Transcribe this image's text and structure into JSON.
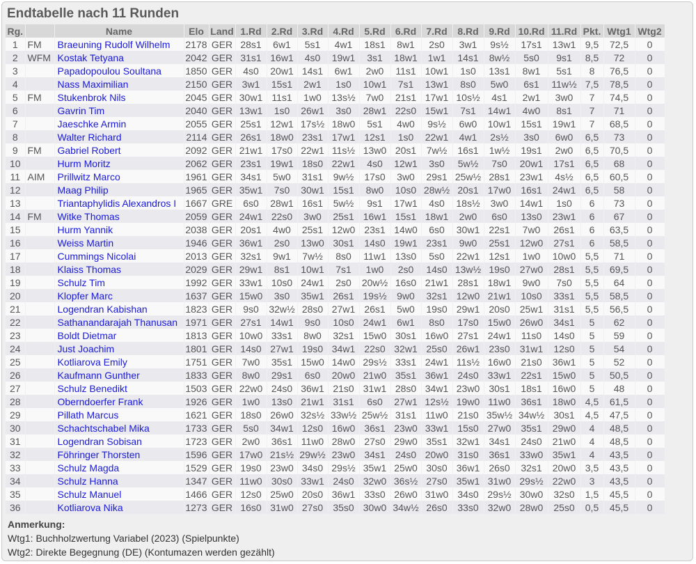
{
  "title": "Endtabelle nach 11 Runden",
  "headers": [
    "Rg.",
    "",
    "Name",
    "Elo",
    "Land",
    "1.Rd",
    "2.Rd",
    "3.Rd",
    "4.Rd",
    "5.Rd",
    "6.Rd",
    "7.Rd",
    "8.Rd",
    "9.Rd",
    "10.Rd",
    "11.Rd",
    "Pkt.",
    "Wtg1",
    "Wtg2"
  ],
  "rows": [
    [
      "1",
      "FM",
      "Braeuning Rudolf Wilhelm",
      "2178",
      "GER",
      "28s1",
      "6w1",
      "5s1",
      "4w1",
      "18s1",
      "8w1",
      "2s0",
      "3w1",
      "9s½",
      "17s1",
      "13w1",
      "9,5",
      "72,5",
      "0"
    ],
    [
      "2",
      "WFM",
      "Kostak Tetyana",
      "2042",
      "GER",
      "31s1",
      "16w1",
      "4s0",
      "19w1",
      "3s1",
      "18w1",
      "1w1",
      "14s1",
      "8w½",
      "5s0",
      "9s1",
      "8,5",
      "72",
      "0"
    ],
    [
      "3",
      "",
      "Papadopoulou Soultana",
      "1850",
      "GER",
      "4s0",
      "20w1",
      "14s1",
      "6w1",
      "2w0",
      "11s1",
      "10w1",
      "1s0",
      "13s1",
      "8w1",
      "5s1",
      "8",
      "76,5",
      "0"
    ],
    [
      "4",
      "",
      "Nass Maximilian",
      "2150",
      "GER",
      "3w1",
      "15s1",
      "2w1",
      "1s0",
      "10w1",
      "7s1",
      "13w1",
      "8s0",
      "5w0",
      "6s1",
      "11w½",
      "7,5",
      "78,5",
      "0"
    ],
    [
      "5",
      "FM",
      "Stukenbrok Nils",
      "2045",
      "GER",
      "30w1",
      "11s1",
      "1w0",
      "13s½",
      "7w0",
      "21s1",
      "17w1",
      "10s½",
      "4s1",
      "2w1",
      "3w0",
      "7",
      "74,5",
      "0"
    ],
    [
      "6",
      "",
      "Gavrin Tim",
      "2040",
      "GER",
      "13w1",
      "1s0",
      "26w1",
      "3s0",
      "28w1",
      "22s0",
      "15w1",
      "7s1",
      "14w1",
      "4w0",
      "8s1",
      "7",
      "71",
      "0"
    ],
    [
      "7",
      "",
      "Jaeschke Armin",
      "2055",
      "GER",
      "25s1",
      "12w1",
      "17s½",
      "18w0",
      "5s1",
      "4w0",
      "9s½",
      "6w0",
      "10w1",
      "15s1",
      "19w1",
      "7",
      "68,5",
      "0"
    ],
    [
      "8",
      "",
      "Walter Richard",
      "2114",
      "GER",
      "26s1",
      "18w0",
      "23s1",
      "17w1",
      "12s1",
      "1s0",
      "22w1",
      "4w1",
      "2s½",
      "3s0",
      "6w0",
      "6,5",
      "73",
      "0"
    ],
    [
      "9",
      "FM",
      "Gabriel Robert",
      "2092",
      "GER",
      "21w1",
      "17s0",
      "22w1",
      "11s½",
      "13w0",
      "20s1",
      "7w½",
      "16s1",
      "1w½",
      "19s1",
      "2w0",
      "6,5",
      "70,5",
      "0"
    ],
    [
      "10",
      "",
      "Hurm Moritz",
      "2062",
      "GER",
      "23s1",
      "19w1",
      "18s0",
      "22w1",
      "4s0",
      "12w1",
      "3s0",
      "5w½",
      "7s0",
      "20w1",
      "17s1",
      "6,5",
      "68",
      "0"
    ],
    [
      "11",
      "AIM",
      "Prillwitz Marco",
      "1961",
      "GER",
      "34s1",
      "5w0",
      "31s1",
      "9w½",
      "17s0",
      "3w0",
      "29s1",
      "25w½",
      "28s1",
      "23w1",
      "4s½",
      "6,5",
      "60,5",
      "0"
    ],
    [
      "12",
      "",
      "Maag Philip",
      "1965",
      "GER",
      "35w1",
      "7s0",
      "30w1",
      "15s1",
      "8w0",
      "10s0",
      "28w½",
      "20s1",
      "17w0",
      "16s1",
      "24w1",
      "6,5",
      "58",
      "0"
    ],
    [
      "13",
      "",
      "Triantaphylidis Alexandros I",
      "1667",
      "GRE",
      "6s0",
      "28w1",
      "16s1",
      "5w½",
      "9s1",
      "17w1",
      "4s0",
      "18s½",
      "3w0",
      "14w1",
      "1s0",
      "6",
      "73",
      "0"
    ],
    [
      "14",
      "FM",
      "Witke Thomas",
      "2059",
      "GER",
      "24w1",
      "22s0",
      "3w0",
      "25s1",
      "16w1",
      "15s1",
      "18w1",
      "2w0",
      "6s0",
      "13s0",
      "23w1",
      "6",
      "67",
      "0"
    ],
    [
      "15",
      "",
      "Hurm Yannik",
      "2038",
      "GER",
      "20s1",
      "4w0",
      "25s1",
      "12w0",
      "23s1",
      "14w0",
      "6s0",
      "30w1",
      "22s1",
      "7w0",
      "26s1",
      "6",
      "63,5",
      "0"
    ],
    [
      "16",
      "",
      "Weiss Martin",
      "1946",
      "GER",
      "36w1",
      "2s0",
      "13w0",
      "30s1",
      "14s0",
      "19w1",
      "23s1",
      "9w0",
      "25s1",
      "12w0",
      "27s1",
      "6",
      "58,5",
      "0"
    ],
    [
      "17",
      "",
      "Cummings Nicolai",
      "2013",
      "GER",
      "32s1",
      "9w1",
      "7w½",
      "8s0",
      "11w1",
      "13s0",
      "5s0",
      "22w1",
      "12s1",
      "1w0",
      "10w0",
      "5,5",
      "71",
      "0"
    ],
    [
      "18",
      "",
      "Klaiss Thomas",
      "2029",
      "GER",
      "29w1",
      "8s1",
      "10w1",
      "7s1",
      "1w0",
      "2s0",
      "14s0",
      "13w½",
      "19s0",
      "27w0",
      "28s1",
      "5,5",
      "69,5",
      "0"
    ],
    [
      "19",
      "",
      "Schulz Tim",
      "1992",
      "GER",
      "33w1",
      "10s0",
      "24w1",
      "2s0",
      "20w½",
      "16s0",
      "21w1",
      "28s1",
      "18w1",
      "9w0",
      "7s0",
      "5,5",
      "64",
      "0"
    ],
    [
      "20",
      "",
      "Klopfer Marc",
      "1637",
      "GER",
      "15w0",
      "3s0",
      "35w1",
      "26s1",
      "19s½",
      "9w0",
      "32s1",
      "12w0",
      "21w1",
      "10s0",
      "33s1",
      "5,5",
      "58,5",
      "0"
    ],
    [
      "21",
      "",
      "Logendran Kabishan",
      "1823",
      "GER",
      "9s0",
      "32w½",
      "28s0",
      "27w1",
      "26s1",
      "5w0",
      "19s0",
      "29w1",
      "20s0",
      "25w1",
      "31s1",
      "5,5",
      "56,5",
      "0"
    ],
    [
      "22",
      "",
      "Sathanandarajah Thanusan",
      "1971",
      "GER",
      "27s1",
      "14w1",
      "9s0",
      "10s0",
      "24w1",
      "6w1",
      "8s0",
      "17s0",
      "15w0",
      "26w0",
      "34s1",
      "5",
      "62",
      "0"
    ],
    [
      "23",
      "",
      "Boldt Dietmar",
      "1813",
      "GER",
      "10w0",
      "33s1",
      "8w0",
      "32s1",
      "15w0",
      "30s1",
      "16w0",
      "27s1",
      "24w1",
      "11s0",
      "14s0",
      "5",
      "59",
      "0"
    ],
    [
      "24",
      "",
      "Just Joachim",
      "1801",
      "GER",
      "14s0",
      "27w1",
      "19s0",
      "34w1",
      "22s0",
      "32w1",
      "25s0",
      "26w1",
      "23s0",
      "31w1",
      "12s0",
      "5",
      "54",
      "0"
    ],
    [
      "25",
      "",
      "Kotliarova Emily",
      "1751",
      "GER",
      "7w0",
      "35s1",
      "15w0",
      "14w0",
      "29s½",
      "33s1",
      "24w1",
      "11s½",
      "16w0",
      "21s0",
      "36w1",
      "5",
      "52",
      "0"
    ],
    [
      "26",
      "",
      "Kaufmann Gunther",
      "1833",
      "GER",
      "8w0",
      "29s1",
      "6s0",
      "20w0",
      "21w0",
      "35s1",
      "36w1",
      "24s0",
      "33w1",
      "22s1",
      "15w0",
      "5",
      "50,5",
      "0"
    ],
    [
      "27",
      "",
      "Schulz Benedikt",
      "1503",
      "GER",
      "22w0",
      "24s0",
      "36w1",
      "21s0",
      "31w1",
      "28s0",
      "34w1",
      "23w0",
      "30s1",
      "18s1",
      "16w0",
      "5",
      "48",
      "0"
    ],
    [
      "28",
      "",
      "Oberndoerfer Frank",
      "1926",
      "GER",
      "1w0",
      "13s0",
      "21w1",
      "31s1",
      "6s0",
      "27w1",
      "12s½",
      "19w0",
      "11w0",
      "36s1",
      "18w0",
      "4,5",
      "61,5",
      "0"
    ],
    [
      "29",
      "",
      "Pillath Marcus",
      "1621",
      "GER",
      "18s0",
      "26w0",
      "32s½",
      "33w½",
      "25w½",
      "31s1",
      "11w0",
      "21s0",
      "35w½",
      "34w½",
      "30s1",
      "4,5",
      "47,5",
      "0"
    ],
    [
      "30",
      "",
      "Schachtschabel Mika",
      "1733",
      "GER",
      "5s0",
      "34w1",
      "12s0",
      "16w0",
      "36s1",
      "23w0",
      "33w1",
      "15s0",
      "27w0",
      "35s1",
      "29w0",
      "4",
      "48,5",
      "0"
    ],
    [
      "31",
      "",
      "Logendran Sobisan",
      "1723",
      "GER",
      "2w0",
      "36s1",
      "11w0",
      "28w0",
      "27s0",
      "29w0",
      "35s1",
      "32w1",
      "34s1",
      "24s0",
      "21w0",
      "4",
      "48,5",
      "0"
    ],
    [
      "32",
      "",
      "Föhringer Thorsten",
      "1596",
      "GER",
      "17w0",
      "21s½",
      "29w½",
      "23w0",
      "34s1",
      "24s0",
      "20w0",
      "31s0",
      "36s1",
      "33w0",
      "35w1",
      "4",
      "43,5",
      "0"
    ],
    [
      "33",
      "",
      "Schulz Magda",
      "1529",
      "GER",
      "19s0",
      "23w0",
      "34s0",
      "29s½",
      "35w1",
      "25w0",
      "30s0",
      "36w1",
      "26s0",
      "32s1",
      "20w0",
      "3,5",
      "43,5",
      "0"
    ],
    [
      "34",
      "",
      "Schulz Hanna",
      "1347",
      "GER",
      "11w0",
      "30s0",
      "33w1",
      "24s0",
      "32w0",
      "36s½",
      "27s0",
      "35w1",
      "31w0",
      "29s½",
      "22w0",
      "3",
      "43,5",
      "0"
    ],
    [
      "35",
      "",
      "Schulz Manuel",
      "1466",
      "GER",
      "12s0",
      "25w0",
      "20s0",
      "36w1",
      "33s0",
      "26w0",
      "31w0",
      "34s0",
      "29s½",
      "30w0",
      "32s0",
      "1,5",
      "45,5",
      "0"
    ],
    [
      "36",
      "",
      "Kotliarova Nika",
      "1273",
      "GER",
      "16s0",
      "31w0",
      "27s0",
      "35s0",
      "30w0",
      "34w½",
      "26s0",
      "33s0",
      "32w0",
      "28w0",
      "25s0",
      "0,5",
      "45,5",
      "0"
    ]
  ],
  "notes": {
    "heading": "Anmerkung:",
    "lines": [
      "Wtg1: Buchholzwertung Variabel (2023) (Spielpunkte)",
      "Wtg2: Direkte Begegnung (DE) (Kontumazen werden gezählt)"
    ]
  }
}
